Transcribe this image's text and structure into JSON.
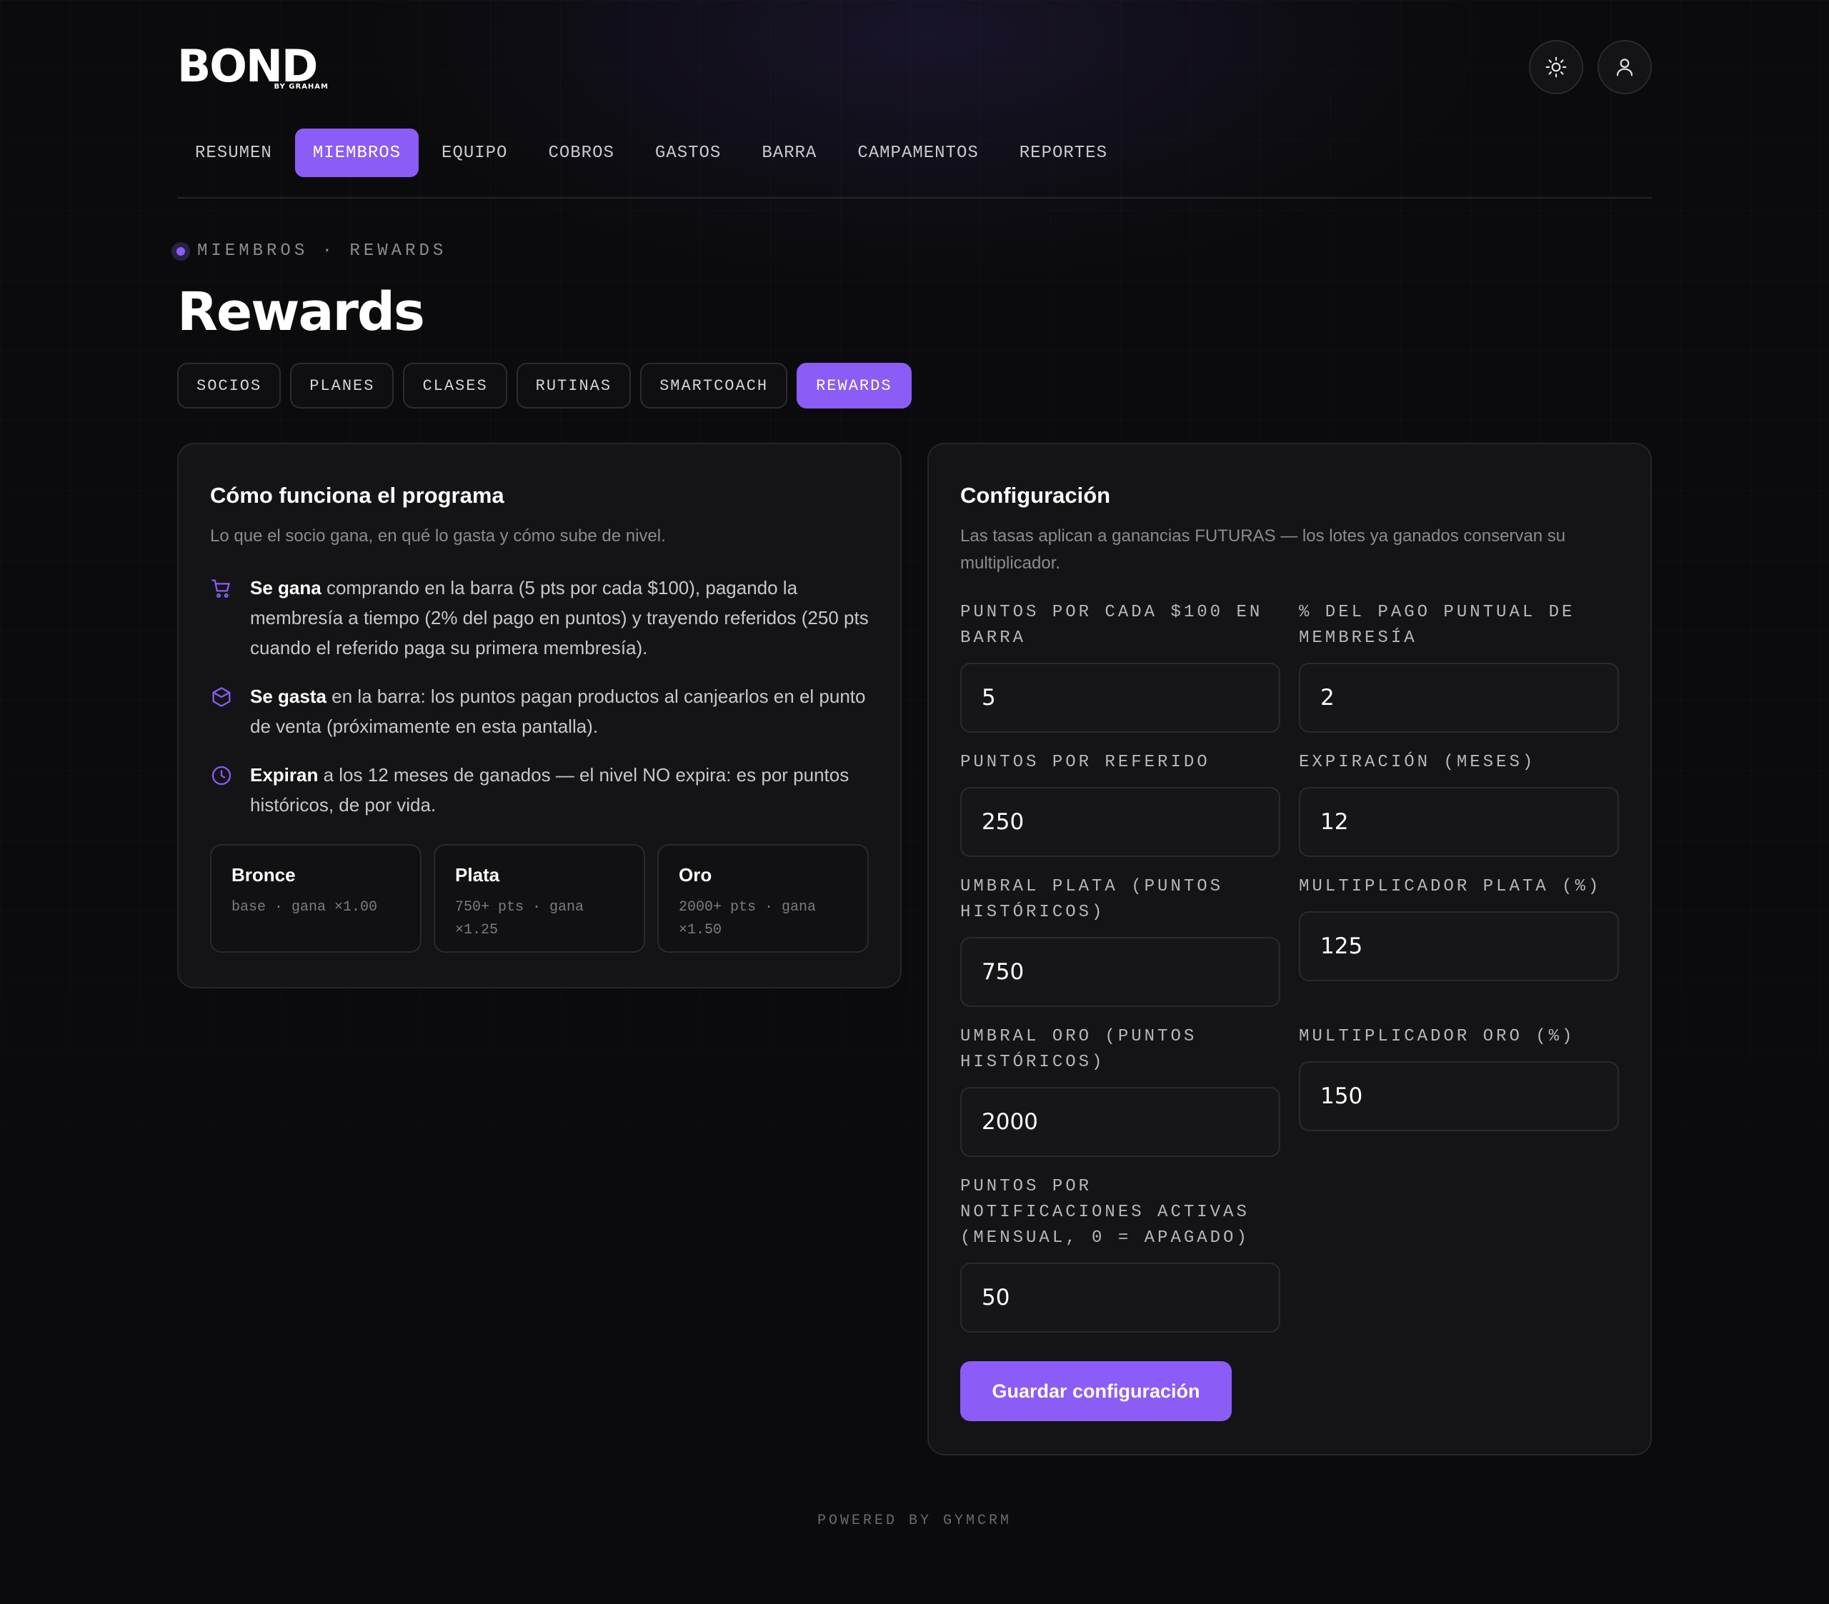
{
  "brand": {
    "logo_text": "BOND",
    "logo_sub": "BY GRAHAM"
  },
  "header": {
    "theme_icon": "sun-icon",
    "user_icon": "user-icon"
  },
  "nav": {
    "items": [
      {
        "label": "RESUMEN",
        "active": false
      },
      {
        "label": "MIEMBROS",
        "active": true
      },
      {
        "label": "EQUIPO",
        "active": false
      },
      {
        "label": "COBROS",
        "active": false
      },
      {
        "label": "GASTOS",
        "active": false
      },
      {
        "label": "BARRA",
        "active": false
      },
      {
        "label": "CAMPAMENTOS",
        "active": false
      },
      {
        "label": "REPORTES",
        "active": false
      }
    ]
  },
  "breadcrumb": {
    "text": "MIEMBROS · REWARDS"
  },
  "page": {
    "title": "Rewards"
  },
  "subtabs": {
    "items": [
      {
        "label": "SOCIOS",
        "active": false
      },
      {
        "label": "PLANES",
        "active": false
      },
      {
        "label": "CLASES",
        "active": false
      },
      {
        "label": "RUTINAS",
        "active": false
      },
      {
        "label": "SMARTCOACH",
        "active": false
      },
      {
        "label": "REWARDS",
        "active": true
      }
    ]
  },
  "program": {
    "title": "Cómo funciona el programa",
    "description": "Lo que el socio gana, en qué lo gasta y cómo sube de nivel.",
    "bullets": [
      {
        "icon": "cart-icon",
        "strong": "Se gana",
        "text": " comprando en la barra (5 pts por cada $100), pagando la membresía a tiempo (2% del pago en puntos) y trayendo referidos (250 pts cuando el referido paga su primera membresía)."
      },
      {
        "icon": "box-icon",
        "strong": "Se gasta",
        "text": " en la barra: los puntos pagan productos al canjearlos en el punto de venta (próximamente en esta pantalla)."
      },
      {
        "icon": "clock-icon",
        "strong": "Expiran",
        "text": " a los 12 meses de ganados — el nivel NO expira: es por puntos históricos, de por vida."
      }
    ],
    "tiers": [
      {
        "name": "Bronce",
        "desc": "base · gana ×1.00"
      },
      {
        "name": "Plata",
        "desc": "750+ pts · gana ×1.25"
      },
      {
        "name": "Oro",
        "desc": "2000+ pts · gana ×1.50"
      }
    ]
  },
  "config": {
    "title": "Configuración",
    "description": "Las tasas aplican a ganancias FUTURAS — los lotes ya ganados conservan su multiplicador.",
    "fields": [
      {
        "label": "PUNTOS POR CADA $100 EN BARRA",
        "value": "5"
      },
      {
        "label": "% DEL PAGO PUNTUAL DE MEMBRESÍA",
        "value": "2"
      },
      {
        "label": "PUNTOS POR REFERIDO",
        "value": "250"
      },
      {
        "label": "EXPIRACIÓN (MESES)",
        "value": "12"
      },
      {
        "label": "UMBRAL PLATA (PUNTOS HISTÓRICOS)",
        "value": "750"
      },
      {
        "label": "MULTIPLICADOR PLATA (%)",
        "value": "125"
      },
      {
        "label": "UMBRAL ORO (PUNTOS HISTÓRICOS)",
        "value": "2000"
      },
      {
        "label": "MULTIPLICADOR ORO (%)",
        "value": "150"
      },
      {
        "label": "PUNTOS POR NOTIFICACIONES ACTIVAS (MENSUAL, 0 = APAGADO)",
        "value": "50"
      }
    ],
    "save_label": "Guardar configuración"
  },
  "footer": {
    "text": "POWERED BY GYMCRM"
  },
  "colors": {
    "accent": "#8b5cf6",
    "background": "#0b0b0d",
    "card": "#141416"
  }
}
